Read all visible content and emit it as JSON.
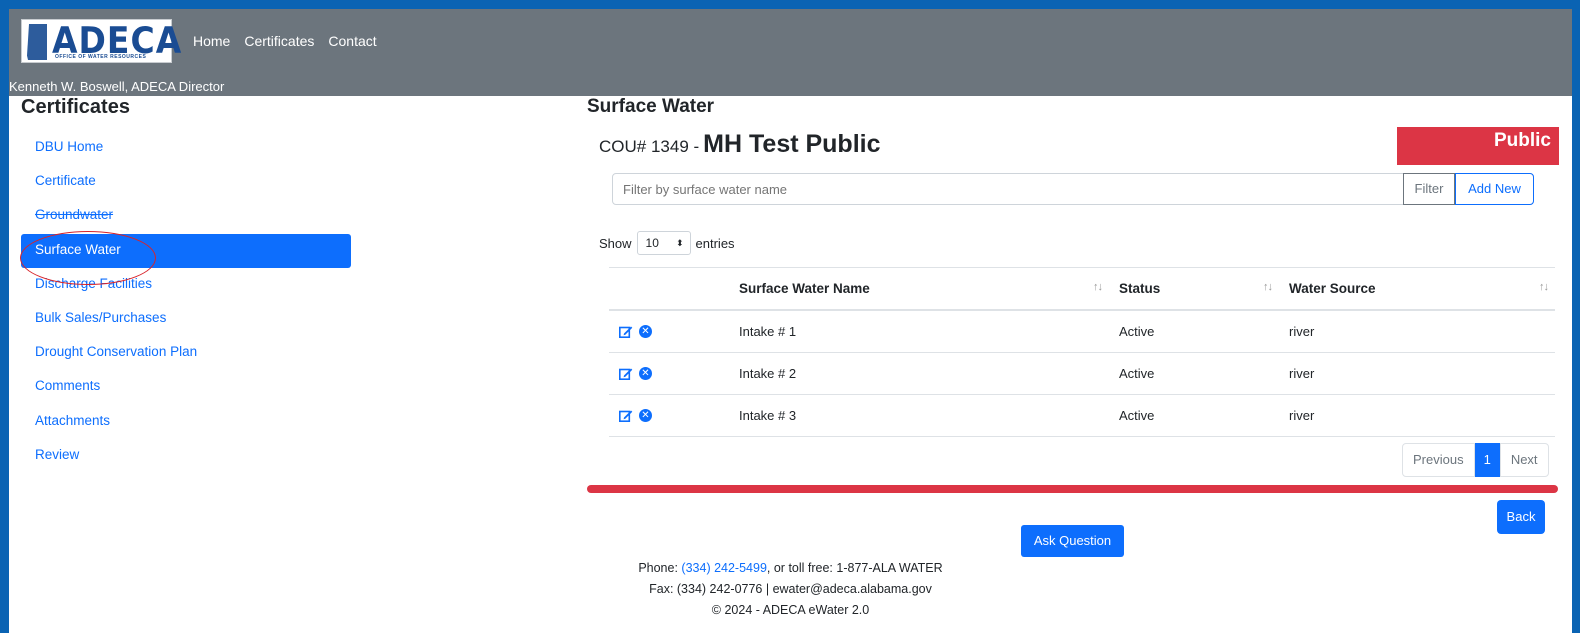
{
  "header": {
    "logo_text": "ADECA",
    "logo_tagline": "OFFICE OF WATER RESOURCES",
    "nav": [
      "Home",
      "Certificates",
      "Contact"
    ],
    "director": "Kenneth W. Boswell, ADECA Director"
  },
  "sidebar": {
    "title": "Certificates",
    "items": [
      {
        "label": "DBU Home"
      },
      {
        "label": "Certificate"
      },
      {
        "label": "Groundwater"
      },
      {
        "label": "Surface Water",
        "active": true
      },
      {
        "label": "Discharge Facilities"
      },
      {
        "label": "Bulk Sales/Purchases"
      },
      {
        "label": "Drought Conservation Plan"
      },
      {
        "label": "Comments"
      },
      {
        "label": "Attachments"
      },
      {
        "label": "Review"
      }
    ]
  },
  "main": {
    "page_title": "Surface Water",
    "cou_prefix": "COU# 1349 -",
    "cou_name": "MH Test Public",
    "badge": "Public",
    "filter_placeholder": "Filter by surface water name",
    "filter_button": "Filter",
    "add_new_button": "Add New",
    "show_label": "Show",
    "show_value": "10",
    "entries_label": "entries",
    "table": {
      "columns": [
        "Surface Water Name",
        "Status",
        "Water Source"
      ],
      "rows": [
        {
          "name": "Intake # 1",
          "status": "Active",
          "source": "river"
        },
        {
          "name": "Intake # 2",
          "status": "Active",
          "source": "river"
        },
        {
          "name": "Intake # 3",
          "status": "Active",
          "source": "river"
        }
      ]
    },
    "pagination": {
      "previous": "Previous",
      "current": "1",
      "next": "Next"
    },
    "back_button": "Back"
  },
  "footer": {
    "ask_button": "Ask Question",
    "phone_label": "Phone:",
    "phone_number": "(334) 242-5499",
    "toll_free": ", or toll free: 1-877-ALA WATER",
    "fax_line": "Fax: (334) 242-0776 | ewater@adeca.alabama.gov",
    "copyright": "© 2024 - ADECA eWater 2.0"
  },
  "colors": {
    "primary": "#0d6efd",
    "danger": "#dc3545",
    "header_bg": "#6c757d",
    "frame_bg": "#0a63b3"
  }
}
